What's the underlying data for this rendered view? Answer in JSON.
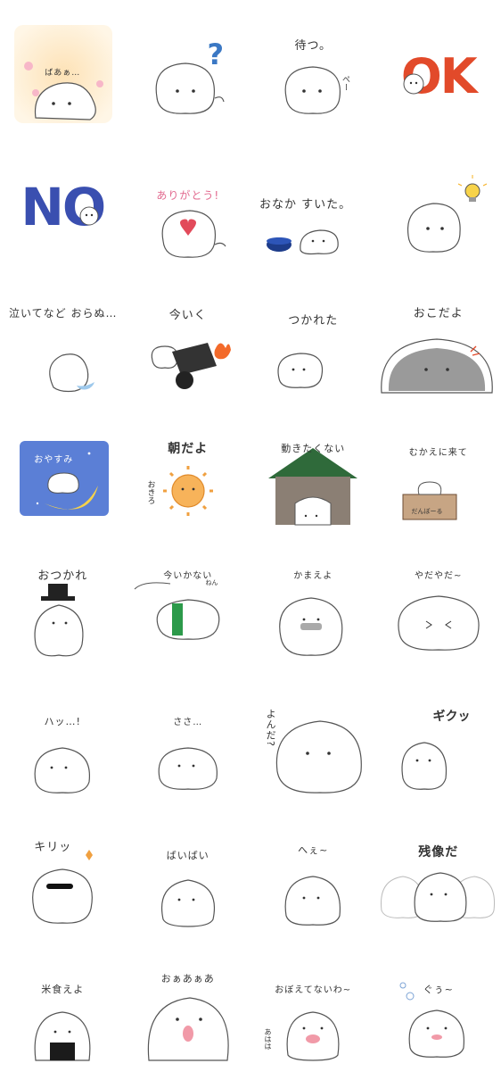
{
  "stickers": [
    {
      "id": 1,
      "caption": "ばあぁ…",
      "bg": "#fde2b6"
    },
    {
      "id": 2,
      "caption": "?",
      "accent": "#3b78c4"
    },
    {
      "id": 3,
      "caption": "待つ。",
      "extra": "ぺー"
    },
    {
      "id": 4,
      "caption": "OK",
      "accent": "#e24a2a"
    },
    {
      "id": 5,
      "caption": "NO",
      "accent": "#3a4fb0"
    },
    {
      "id": 6,
      "caption": "ありがとう!",
      "accent": "#e24a5a"
    },
    {
      "id": 7,
      "caption": "おなか すいた。"
    },
    {
      "id": 8,
      "caption": "",
      "icon": "lightbulb-icon"
    },
    {
      "id": 9,
      "caption": "泣いてなど おらぬ…"
    },
    {
      "id": 10,
      "caption": "今いく"
    },
    {
      "id": 11,
      "caption": "つかれた"
    },
    {
      "id": 12,
      "caption": "おこだよ"
    },
    {
      "id": 13,
      "caption": "おやすみ",
      "bg": "#5b7fd6"
    },
    {
      "id": 14,
      "caption": "朝だよ",
      "extra": "おきろ"
    },
    {
      "id": 15,
      "caption": "動きたくない"
    },
    {
      "id": 16,
      "caption": "むかえに来て",
      "extra": "だんぼーる"
    },
    {
      "id": 17,
      "caption": "おつかれ"
    },
    {
      "id": 18,
      "caption": "今いかない",
      "extra": "ねん"
    },
    {
      "id": 19,
      "caption": "かまえよ"
    },
    {
      "id": 20,
      "caption": "やだやだ~"
    },
    {
      "id": 21,
      "caption": "ハッ…!"
    },
    {
      "id": 22,
      "caption": "ささ…"
    },
    {
      "id": 23,
      "caption": "よんだ?"
    },
    {
      "id": 24,
      "caption": "ギクッ"
    },
    {
      "id": 25,
      "caption": "キリッ"
    },
    {
      "id": 26,
      "caption": "ばいばい"
    },
    {
      "id": 27,
      "caption": "へぇ~"
    },
    {
      "id": 28,
      "caption": "残像だ"
    },
    {
      "id": 29,
      "caption": "米食えよ"
    },
    {
      "id": 30,
      "caption": "おぁあぁあ"
    },
    {
      "id": 31,
      "caption": "おぼえてないわ~",
      "extra": "あはは"
    },
    {
      "id": 32,
      "caption": "ぐぅ~"
    }
  ]
}
